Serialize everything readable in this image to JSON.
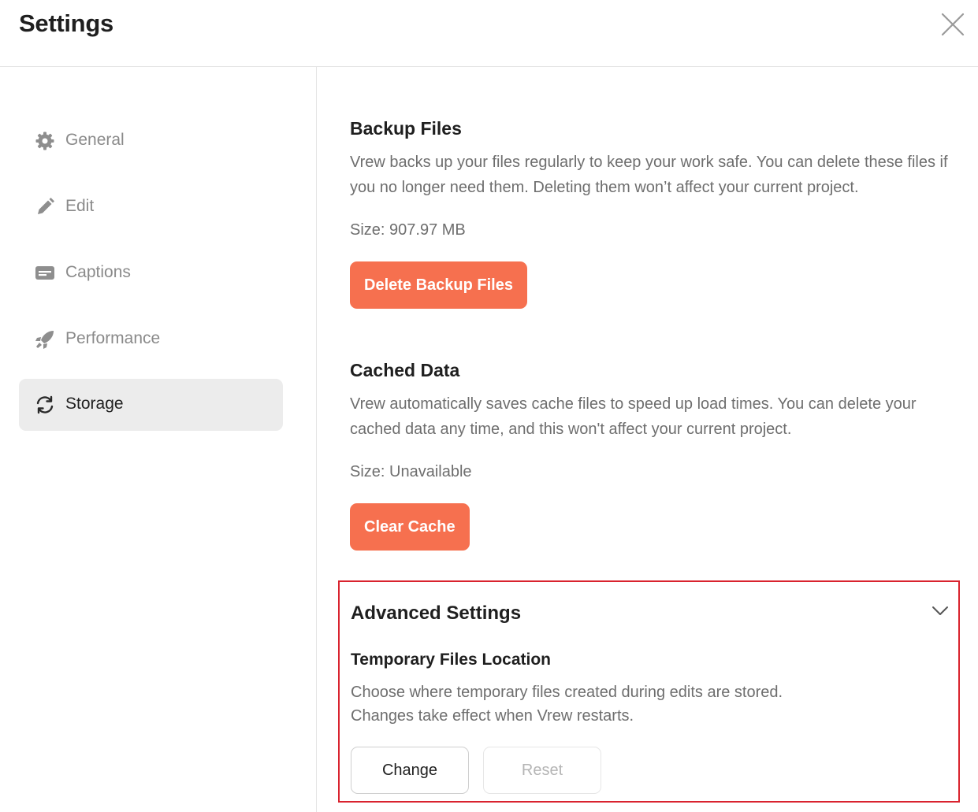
{
  "window": {
    "title": "Settings"
  },
  "sidebar": {
    "items": [
      {
        "label": "General",
        "icon": "gear-icon",
        "active": false
      },
      {
        "label": "Edit",
        "icon": "pencil-icon",
        "active": false
      },
      {
        "label": "Captions",
        "icon": "captions-icon",
        "active": false
      },
      {
        "label": "Performance",
        "icon": "rocket-icon",
        "active": false
      },
      {
        "label": "Storage",
        "icon": "sync-icon",
        "active": true
      }
    ]
  },
  "backup": {
    "title": "Backup Files",
    "description": "Vrew backs up your files regularly to keep your work safe. You can delete these files if you no longer need them. Deleting them won’t affect your current project.",
    "size": "Size: 907.97 MB",
    "button": "Delete Backup Files"
  },
  "cache": {
    "title": "Cached Data",
    "description": "Vrew automatically saves cache files to speed up load times. You can delete your cached data any time, and this won't affect your current project.",
    "size": "Size: Unavailable",
    "button": "Clear Cache"
  },
  "advanced": {
    "title": "Advanced Settings",
    "temp_title": "Temporary Files Location",
    "temp_desc_line1": "Choose where temporary files created during edits are stored.",
    "temp_desc_line2": "Changes take effect when Vrew restarts.",
    "change_button": "Change",
    "reset_button": "Reset"
  },
  "colors": {
    "accent": "#f6704f",
    "highlight_border": "#d9232e",
    "active_nav_bg": "#ececec"
  }
}
